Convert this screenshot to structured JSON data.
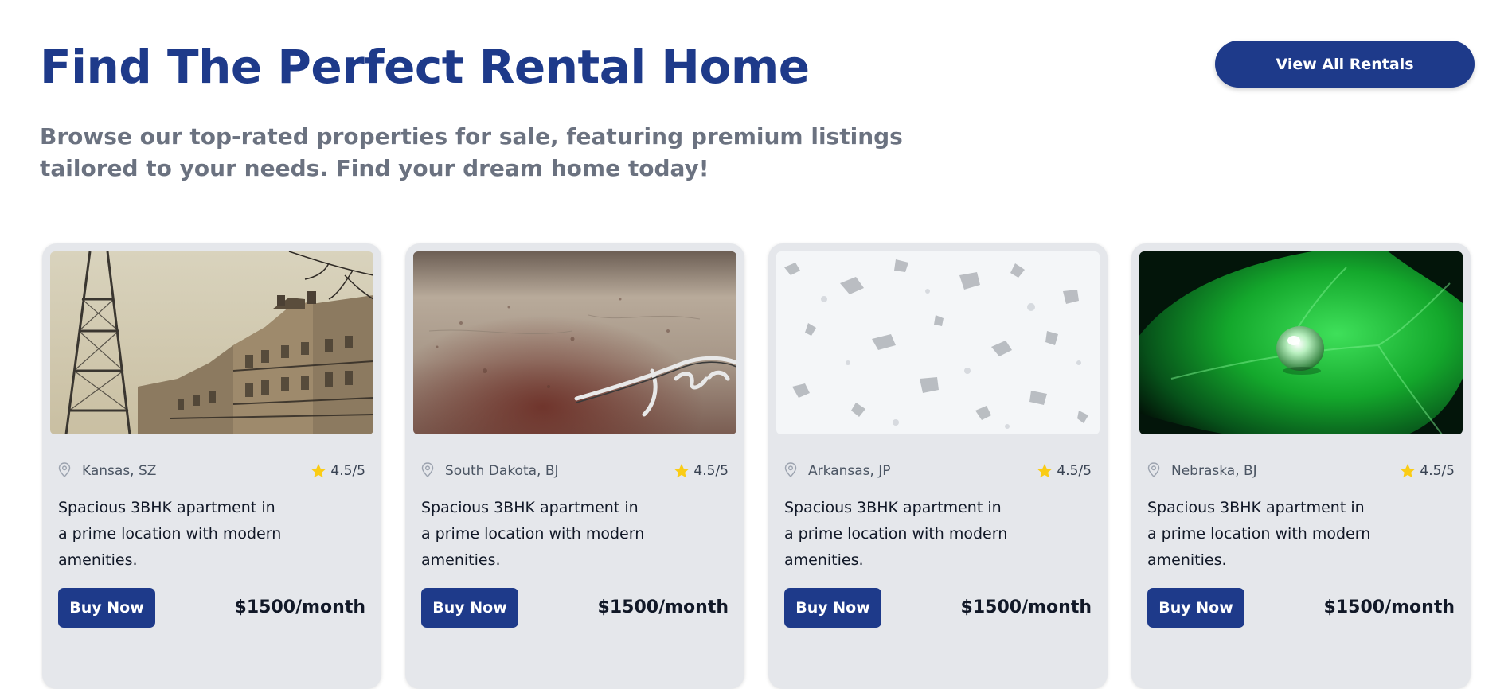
{
  "header": {
    "title": "Find The Perfect Rental Home",
    "subtitle": "Browse our top-rated properties for sale, featuring premium listings tailored to your needs. Find your dream home today!",
    "view_all_label": "View All Rentals"
  },
  "icons": {
    "location": "map-pin-icon",
    "rating": "star-icon"
  },
  "colors": {
    "accent": "#1e3a8a",
    "card_bg": "#e5e7eb",
    "star": "#facc15"
  },
  "listings": [
    {
      "image": "paris-buildings-photo",
      "location": "Kansas, SZ",
      "rating": "4.5/5",
      "description": "Spacious 3BHK apartment in a prime location with modern amenities.",
      "buy_label": "Buy Now",
      "price": "$1500/month"
    },
    {
      "image": "rusted-car-emblem-photo",
      "location": "South Dakota, BJ",
      "rating": "4.5/5",
      "description": "Spacious 3BHK apartment in a prime location with modern amenities.",
      "buy_label": "Buy Now",
      "price": "$1500/month"
    },
    {
      "image": "white-texture-photo",
      "location": "Arkansas, JP",
      "rating": "4.5/5",
      "description": "Spacious 3BHK apartment in a prime location with modern amenities.",
      "buy_label": "Buy Now",
      "price": "$1500/month"
    },
    {
      "image": "green-leaf-droplet-photo",
      "location": "Nebraska, BJ",
      "rating": "4.5/5",
      "description": "Spacious 3BHK apartment in a prime location with modern amenities.",
      "buy_label": "Buy Now",
      "price": "$1500/month"
    }
  ]
}
